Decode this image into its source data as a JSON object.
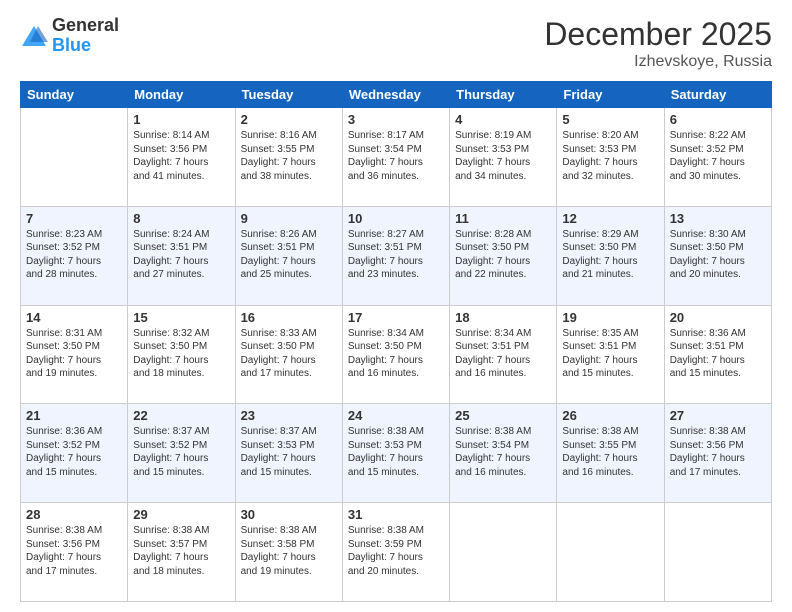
{
  "header": {
    "logo_general": "General",
    "logo_blue": "Blue",
    "month": "December 2025",
    "location": "Izhevskoye, Russia"
  },
  "weekdays": [
    "Sunday",
    "Monday",
    "Tuesday",
    "Wednesday",
    "Thursday",
    "Friday",
    "Saturday"
  ],
  "weeks": [
    [
      {
        "day": "",
        "info": ""
      },
      {
        "day": "1",
        "info": "Sunrise: 8:14 AM\nSunset: 3:56 PM\nDaylight: 7 hours\nand 41 minutes."
      },
      {
        "day": "2",
        "info": "Sunrise: 8:16 AM\nSunset: 3:55 PM\nDaylight: 7 hours\nand 38 minutes."
      },
      {
        "day": "3",
        "info": "Sunrise: 8:17 AM\nSunset: 3:54 PM\nDaylight: 7 hours\nand 36 minutes."
      },
      {
        "day": "4",
        "info": "Sunrise: 8:19 AM\nSunset: 3:53 PM\nDaylight: 7 hours\nand 34 minutes."
      },
      {
        "day": "5",
        "info": "Sunrise: 8:20 AM\nSunset: 3:53 PM\nDaylight: 7 hours\nand 32 minutes."
      },
      {
        "day": "6",
        "info": "Sunrise: 8:22 AM\nSunset: 3:52 PM\nDaylight: 7 hours\nand 30 minutes."
      }
    ],
    [
      {
        "day": "7",
        "info": "Sunrise: 8:23 AM\nSunset: 3:52 PM\nDaylight: 7 hours\nand 28 minutes."
      },
      {
        "day": "8",
        "info": "Sunrise: 8:24 AM\nSunset: 3:51 PM\nDaylight: 7 hours\nand 27 minutes."
      },
      {
        "day": "9",
        "info": "Sunrise: 8:26 AM\nSunset: 3:51 PM\nDaylight: 7 hours\nand 25 minutes."
      },
      {
        "day": "10",
        "info": "Sunrise: 8:27 AM\nSunset: 3:51 PM\nDaylight: 7 hours\nand 23 minutes."
      },
      {
        "day": "11",
        "info": "Sunrise: 8:28 AM\nSunset: 3:50 PM\nDaylight: 7 hours\nand 22 minutes."
      },
      {
        "day": "12",
        "info": "Sunrise: 8:29 AM\nSunset: 3:50 PM\nDaylight: 7 hours\nand 21 minutes."
      },
      {
        "day": "13",
        "info": "Sunrise: 8:30 AM\nSunset: 3:50 PM\nDaylight: 7 hours\nand 20 minutes."
      }
    ],
    [
      {
        "day": "14",
        "info": "Sunrise: 8:31 AM\nSunset: 3:50 PM\nDaylight: 7 hours\nand 19 minutes."
      },
      {
        "day": "15",
        "info": "Sunrise: 8:32 AM\nSunset: 3:50 PM\nDaylight: 7 hours\nand 18 minutes."
      },
      {
        "day": "16",
        "info": "Sunrise: 8:33 AM\nSunset: 3:50 PM\nDaylight: 7 hours\nand 17 minutes."
      },
      {
        "day": "17",
        "info": "Sunrise: 8:34 AM\nSunset: 3:50 PM\nDaylight: 7 hours\nand 16 minutes."
      },
      {
        "day": "18",
        "info": "Sunrise: 8:34 AM\nSunset: 3:51 PM\nDaylight: 7 hours\nand 16 minutes."
      },
      {
        "day": "19",
        "info": "Sunrise: 8:35 AM\nSunset: 3:51 PM\nDaylight: 7 hours\nand 15 minutes."
      },
      {
        "day": "20",
        "info": "Sunrise: 8:36 AM\nSunset: 3:51 PM\nDaylight: 7 hours\nand 15 minutes."
      }
    ],
    [
      {
        "day": "21",
        "info": "Sunrise: 8:36 AM\nSunset: 3:52 PM\nDaylight: 7 hours\nand 15 minutes."
      },
      {
        "day": "22",
        "info": "Sunrise: 8:37 AM\nSunset: 3:52 PM\nDaylight: 7 hours\nand 15 minutes."
      },
      {
        "day": "23",
        "info": "Sunrise: 8:37 AM\nSunset: 3:53 PM\nDaylight: 7 hours\nand 15 minutes."
      },
      {
        "day": "24",
        "info": "Sunrise: 8:38 AM\nSunset: 3:53 PM\nDaylight: 7 hours\nand 15 minutes."
      },
      {
        "day": "25",
        "info": "Sunrise: 8:38 AM\nSunset: 3:54 PM\nDaylight: 7 hours\nand 16 minutes."
      },
      {
        "day": "26",
        "info": "Sunrise: 8:38 AM\nSunset: 3:55 PM\nDaylight: 7 hours\nand 16 minutes."
      },
      {
        "day": "27",
        "info": "Sunrise: 8:38 AM\nSunset: 3:56 PM\nDaylight: 7 hours\nand 17 minutes."
      }
    ],
    [
      {
        "day": "28",
        "info": "Sunrise: 8:38 AM\nSunset: 3:56 PM\nDaylight: 7 hours\nand 17 minutes."
      },
      {
        "day": "29",
        "info": "Sunrise: 8:38 AM\nSunset: 3:57 PM\nDaylight: 7 hours\nand 18 minutes."
      },
      {
        "day": "30",
        "info": "Sunrise: 8:38 AM\nSunset: 3:58 PM\nDaylight: 7 hours\nand 19 minutes."
      },
      {
        "day": "31",
        "info": "Sunrise: 8:38 AM\nSunset: 3:59 PM\nDaylight: 7 hours\nand 20 minutes."
      },
      {
        "day": "",
        "info": ""
      },
      {
        "day": "",
        "info": ""
      },
      {
        "day": "",
        "info": ""
      }
    ]
  ]
}
